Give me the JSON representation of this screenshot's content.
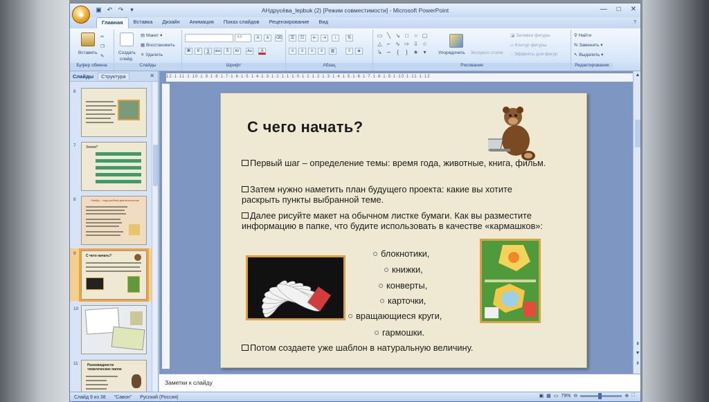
{
  "window": {
    "title": "АНдрусёва_lepbuk (2) [Режим совместимости] - Microsoft PowerPoint",
    "office_button_icon": "office-logo-icon",
    "qat": [
      "save-icon",
      "undo-icon",
      "redo-icon",
      "dropdown-icon"
    ],
    "controls": [
      "—",
      "□",
      "✕"
    ]
  },
  "ribbon_tabs": [
    "Главная",
    "Вставка",
    "Дизайн",
    "Анимация",
    "Показ слайдов",
    "Рецензирование",
    "Вид"
  ],
  "ribbon": {
    "clipboard": {
      "label": "Буфер обмена",
      "paste": "Вставить"
    },
    "slides": {
      "label": "Слайды",
      "new_slide_1": "Создать",
      "new_slide_2": "слайд",
      "layout": "Макет",
      "reset": "Восстановить",
      "delete": "Удалить"
    },
    "font": {
      "label": "Шрифт",
      "size": "44",
      "grow": "A",
      "shrink": "A",
      "bold": "Ж",
      "italic": "К",
      "underline": "Ч",
      "strike": "abe",
      "shadow": "S",
      "spacing": "AV",
      "case": "Aa",
      "color": "A"
    },
    "paragraph": {
      "label": "Абзац"
    },
    "drawing": {
      "label": "Рисование",
      "arrange": "Упорядочить",
      "quick_styles": "Экспресс-стили",
      "fill": "Заливка фигуры",
      "outline": "Контур фигуры",
      "effects": "Эффекты для фигур"
    },
    "editing": {
      "label": "Редактирование",
      "find": "Найти",
      "replace": "Заменить",
      "select": "Выделить"
    }
  },
  "panel": {
    "tab_slides": "Слайды",
    "tab_outline": "Структура",
    "close": "✕",
    "thumbnails": [
      {
        "num": "6",
        "title": "",
        "selected": false
      },
      {
        "num": "7",
        "title": "Зачем?",
        "selected": false
      },
      {
        "num": "8",
        "title": "Лэпбук – над учебной деятельностью",
        "selected": false
      },
      {
        "num": "9",
        "title": "С чего начать?",
        "selected": true
      },
      {
        "num": "10",
        "title": "",
        "selected": false
      },
      {
        "num": "11",
        "title": "Разновидности тематических папок",
        "selected": false
      }
    ]
  },
  "ruler": {
    "h": "12·1·11·1·10·1·9·1·8·1·7·1·6·1·5·1·4·1·3·1·2·1·1·1·0·1·1·1·2·1·3·1·4·1·5·1·6·1·7·1·8·1·9·1·10·1·11·1·12"
  },
  "slide": {
    "title": "С чего начать?",
    "bullets": [
      "Первый шаг – определение темы: время года, животные, книга, фильм.",
      "Затем нужно наметить план будущего проекта: какие вы хотите раскрыть пункты выбранной теме.",
      "Далее рисуйте макет на обычном листке бумаги. Как вы разместите информацию в папке, что будите использовать в качестве «кармашков»:"
    ],
    "subitems": [
      "блокнотики,",
      "книжки,",
      "конверты,",
      "карточки,",
      "вращающиеся круги,",
      "гармошки."
    ],
    "last_bullet": "Потом создаете уже шаблон в натуральную величину."
  },
  "notes": {
    "placeholder": "Заметки к слайду"
  },
  "status": {
    "slide": "Слайд 9 из 38",
    "theme": "\"Савон\"",
    "language": "Русский (Россия)",
    "zoom": "79%"
  }
}
